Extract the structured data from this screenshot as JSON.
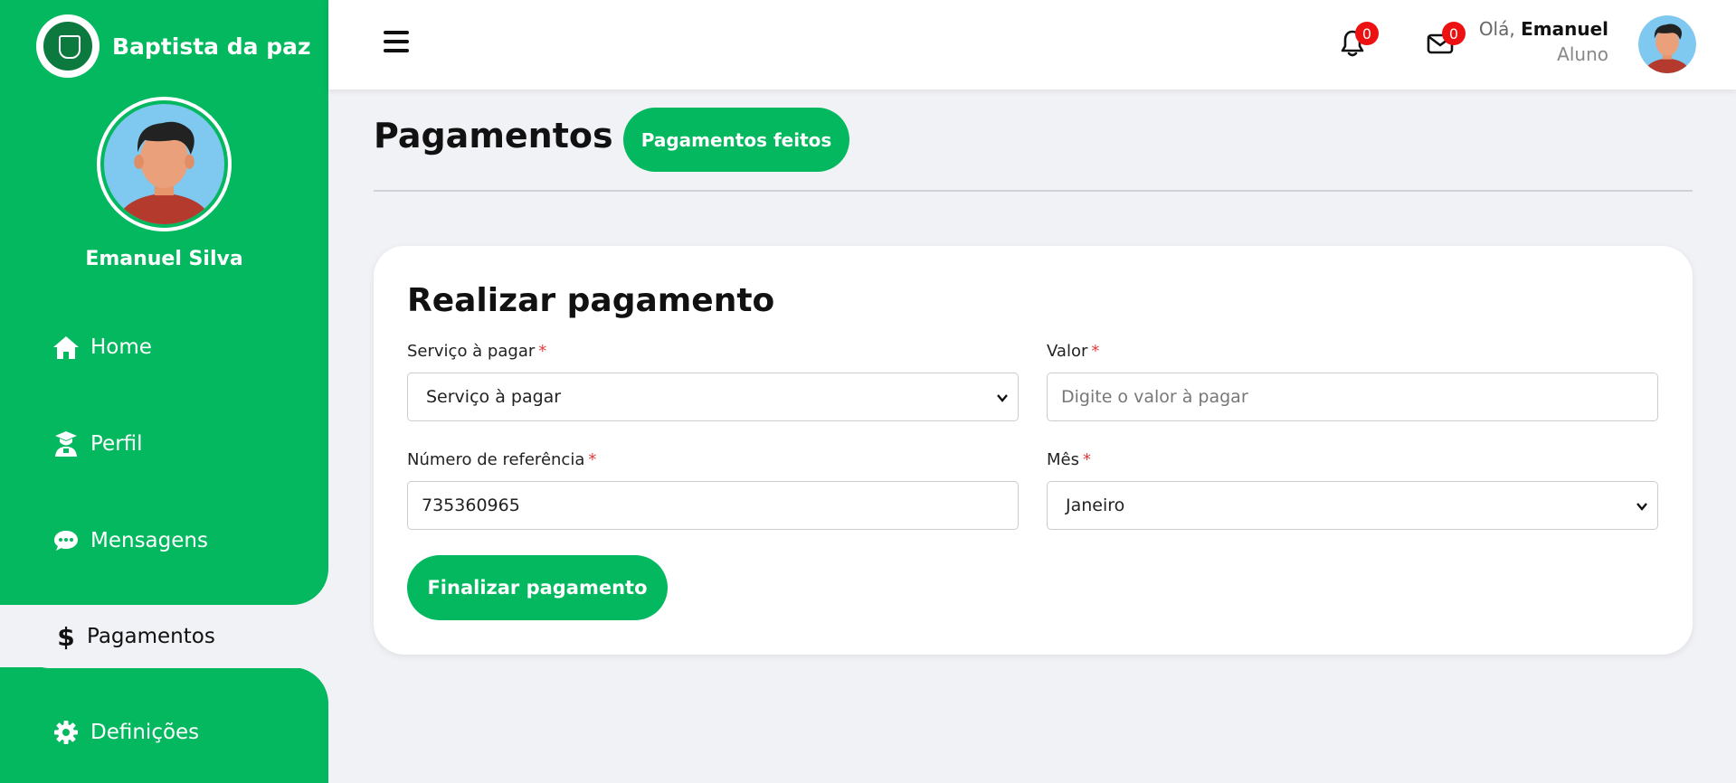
{
  "brand": {
    "name": "Baptista da paz"
  },
  "profile": {
    "name": "Emanuel Silva"
  },
  "sidebar": {
    "items": [
      {
        "label": "Home",
        "icon": "home-icon"
      },
      {
        "label": "Perfil",
        "icon": "graduate-icon"
      },
      {
        "label": "Mensagens",
        "icon": "chat-icon"
      },
      {
        "label": "Pagamentos",
        "icon": "dollar-icon",
        "active": true
      },
      {
        "label": "Definições",
        "icon": "gear-icon"
      }
    ]
  },
  "header": {
    "notifications_count": "0",
    "messages_count": "0",
    "greeting_prefix": "Olá,",
    "user_first_name": "Emanuel",
    "user_role": "Aluno"
  },
  "main": {
    "page_title": "Pagamentos",
    "payments_made_label": "Pagamentos feitos"
  },
  "form": {
    "title": "Realizar pagamento",
    "service_label": "Serviço à pagar",
    "service_value": "Serviço à pagar",
    "value_label": "Valor",
    "value_placeholder": "Digite o valor à pagar",
    "reference_label": "Número de referência",
    "reference_value": "735360965",
    "month_label": "Mês",
    "month_value": "Janeiro",
    "required_mark": "*",
    "submit_label": "Finalizar pagamento"
  },
  "colors": {
    "brand_green": "#03b85f",
    "badge_red": "#ee1111",
    "background": "#f1f2f6"
  }
}
